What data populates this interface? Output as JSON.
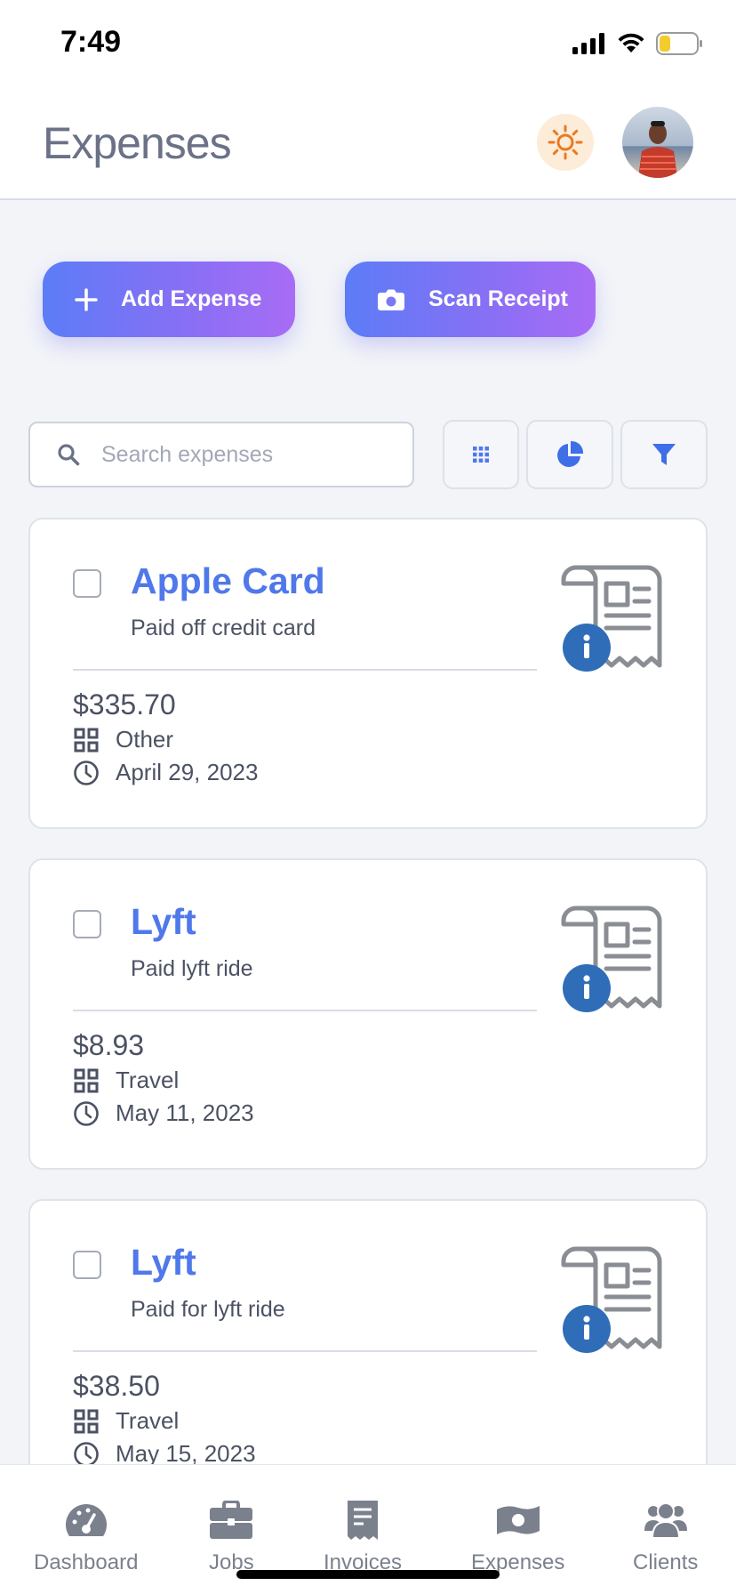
{
  "status_bar": {
    "time": "7:49"
  },
  "header": {
    "title": "Expenses",
    "theme_icon": "sun-icon",
    "accent_color": "#e87a22"
  },
  "actions": {
    "add_label": "Add Expense",
    "scan_label": "Scan Receipt"
  },
  "search": {
    "placeholder": "Search expenses",
    "value": ""
  },
  "tools": [
    "grid-view-icon",
    "pie-chart-icon",
    "filter-icon"
  ],
  "expenses": [
    {
      "merchant": "Apple Card",
      "description": "Paid off credit card",
      "amount": "$335.70",
      "category": "Other",
      "date": "April 29, 2023",
      "checked": false
    },
    {
      "merchant": "Lyft",
      "description": "Paid lyft ride",
      "amount": "$8.93",
      "category": "Travel",
      "date": "May 11, 2023",
      "checked": false
    },
    {
      "merchant": "Lyft",
      "description": "Paid for lyft ride",
      "amount": "$38.50",
      "category": "Travel",
      "date": "May 15, 2023",
      "checked": false
    }
  ],
  "nav": {
    "items": [
      {
        "label": "Dashboard",
        "icon": "dashboard-icon"
      },
      {
        "label": "Jobs",
        "icon": "briefcase-icon"
      },
      {
        "label": "Invoices",
        "icon": "receipt-icon"
      },
      {
        "label": "Expenses",
        "icon": "money-icon"
      },
      {
        "label": "Clients",
        "icon": "users-icon"
      }
    ]
  },
  "colors": {
    "link_blue": "#4f78ea",
    "info_badge": "#2f6db8",
    "button_gradient_start": "#5c7cf6",
    "button_gradient_end": "#a86cf5"
  }
}
